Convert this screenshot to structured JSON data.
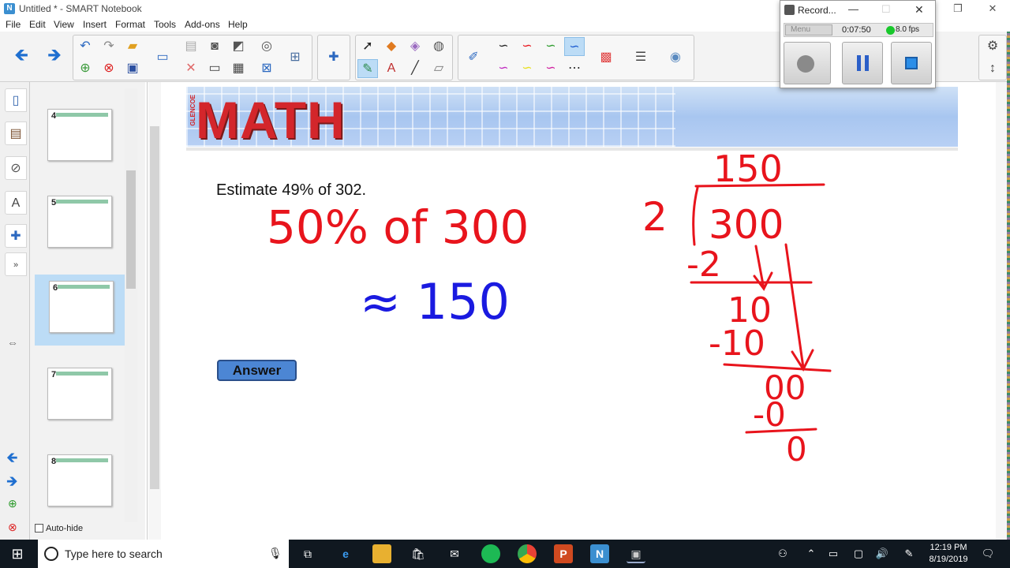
{
  "window": {
    "title": "Untitled * - SMART Notebook",
    "app_icon_letter": "N",
    "minimize": "—",
    "restore": "❐",
    "close": "✕"
  },
  "menu": [
    "File",
    "Edit",
    "View",
    "Insert",
    "Format",
    "Tools",
    "Add-ons",
    "Help"
  ],
  "sorter": {
    "pages": [
      {
        "num": "4"
      },
      {
        "num": "5"
      },
      {
        "num": "6",
        "selected": true
      },
      {
        "num": "7"
      },
      {
        "num": "8"
      }
    ],
    "autohide_label": "Auto-hide"
  },
  "slide": {
    "banner_logo": "MATH",
    "banner_sub": "GLENCOE",
    "question": "Estimate 49% of 302.",
    "answer_button": "Answer"
  },
  "ink": {
    "line1": "50% of 300",
    "line2": "≈ 150",
    "division_quotient": "150",
    "division_divisor": "2",
    "division_dividend": "300"
  },
  "recorder": {
    "title": "Record...",
    "menu": "Menu",
    "time": "0:07:50",
    "fps": "8.0 fps"
  },
  "taskbar": {
    "search_placeholder": "Type here to search",
    "time": "12:19 PM",
    "date": "8/19/2019"
  },
  "colors": {
    "ink_red": "#e8141c",
    "ink_blue": "#1a1ae0",
    "answer_button": "#4c86d4",
    "banner": "#a8c6f0"
  }
}
